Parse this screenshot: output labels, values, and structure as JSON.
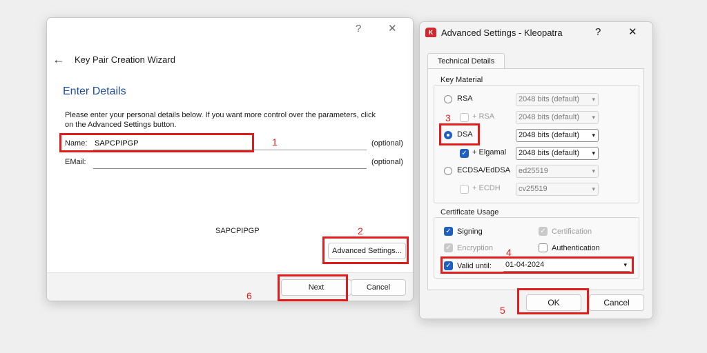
{
  "wizard": {
    "help": "?",
    "close": "✕",
    "back": "←",
    "title": "Key Pair Creation Wizard",
    "heading": "Enter Details",
    "description_line1": "Please enter your personal details below. If you want more control over the parameters, click",
    "description_line2": "on the Advanced Settings button.",
    "name_label": "Name:",
    "name_value": "SAPCPIPGP",
    "name_optional": "(optional)",
    "email_label": "EMail:",
    "email_value": "",
    "email_optional": "(optional)",
    "preview": "SAPCPIPGP",
    "advanced_button": "Advanced Settings...",
    "next_button": "Next",
    "cancel_button": "Cancel"
  },
  "advanced": {
    "app_icon_letter": "K",
    "title": "Advanced Settings - Kleopatra",
    "help": "?",
    "close": "✕",
    "tab": "Technical Details",
    "key_material": {
      "legend": "Key Material",
      "rsa_label": "RSA",
      "rsa_bits": "2048 bits (default)",
      "plus_rsa_label": "+ RSA",
      "plus_rsa_bits": "2048 bits (default)",
      "dsa_label": "DSA",
      "dsa_bits": "2048 bits (default)",
      "elgamal_label": "+ Elgamal",
      "elgamal_bits": "2048 bits (default)",
      "ecdsa_label": "ECDSA/EdDSA",
      "ecdsa_curve": "ed25519",
      "ecdh_label": "+ ECDH",
      "ecdh_curve": "cv25519"
    },
    "certificate_usage": {
      "legend": "Certificate Usage",
      "signing": "Signing",
      "certification": "Certification",
      "encryption": "Encryption",
      "authentication": "Authentication",
      "valid_until_label": "Valid until:",
      "valid_until_value": "01-04-2024"
    },
    "ok_button": "OK",
    "cancel_button": "Cancel"
  },
  "annotations": {
    "n1": "1",
    "n2": "2",
    "n3": "3",
    "n4": "4",
    "n5": "5",
    "n6": "6"
  },
  "colors": {
    "accent": "#1f5fbf",
    "heading": "#1f4e9c",
    "annotation": "#e21b1b"
  },
  "icons": {
    "arrow": "▾",
    "check": "✓"
  }
}
